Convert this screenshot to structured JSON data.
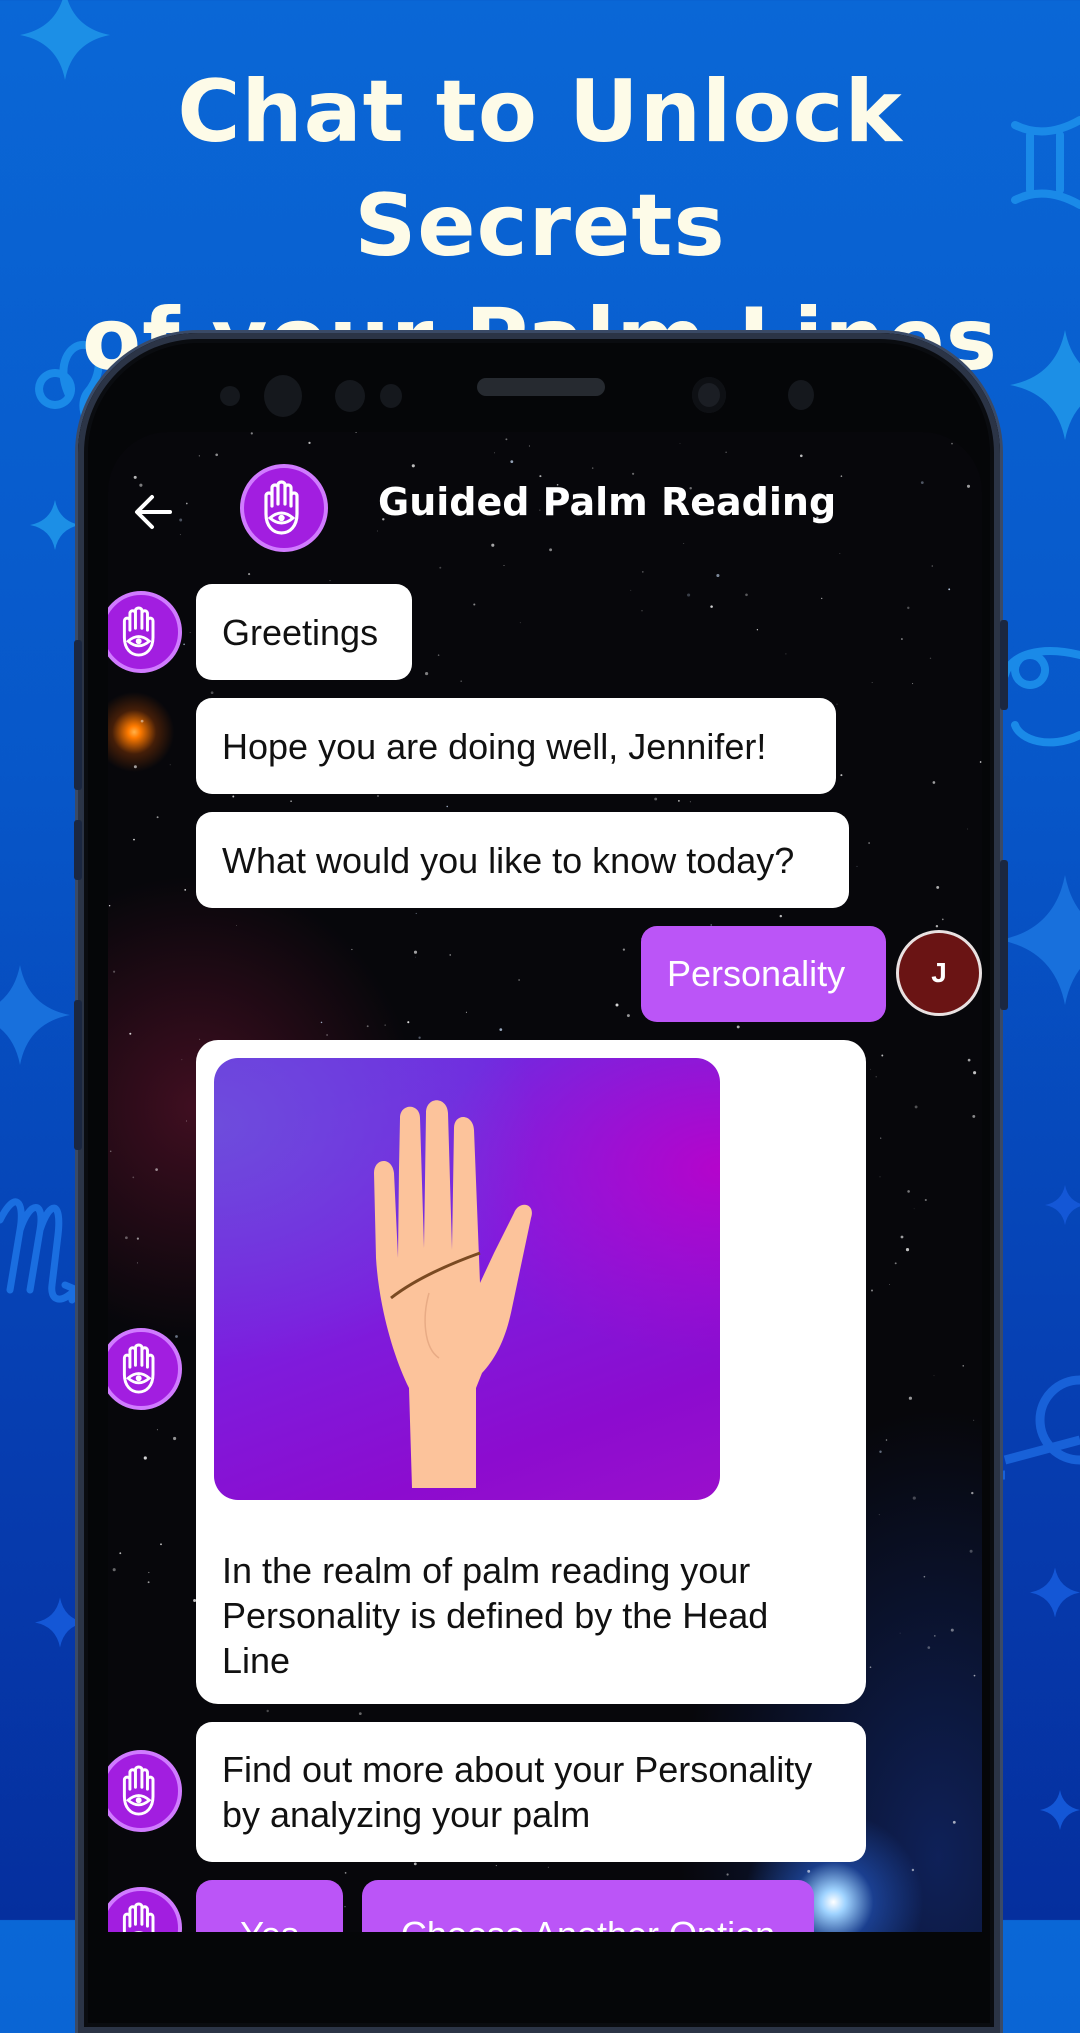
{
  "promo": {
    "headline_line1": "Chat to Unlock Secrets",
    "headline_line2": "of your Palm Lines"
  },
  "app": {
    "title": "Guided Palm Reading",
    "back_icon": "arrow-left-icon",
    "bot_avatar_icon": "hamsa-hand-eye-icon"
  },
  "colors": {
    "background_blue": "#0757c9",
    "bot_purple": "#a21ee0",
    "user_bubble_purple": "#bb55f7",
    "user_avatar_maroon": "#6a1414",
    "headline_cream": "#fdfbe8"
  },
  "chat": {
    "messages": [
      {
        "sender": "bot",
        "text": "Greetings"
      },
      {
        "sender": "bot",
        "text": "Hope you are doing well,  Jennifer!"
      },
      {
        "sender": "bot",
        "text": "What would you like to know today?"
      },
      {
        "sender": "user",
        "text": "Personality"
      },
      {
        "sender": "bot",
        "type": "image_card",
        "image": "palm-head-line-illustration",
        "text": "In the realm of palm reading your Personality is defined by the Head Line"
      },
      {
        "sender": "bot",
        "text": "Find out more about your Personality by analyzing your palm"
      }
    ],
    "user_initial": "J",
    "options": [
      {
        "label": "Yes"
      },
      {
        "label": "Choose Another Option"
      }
    ]
  }
}
